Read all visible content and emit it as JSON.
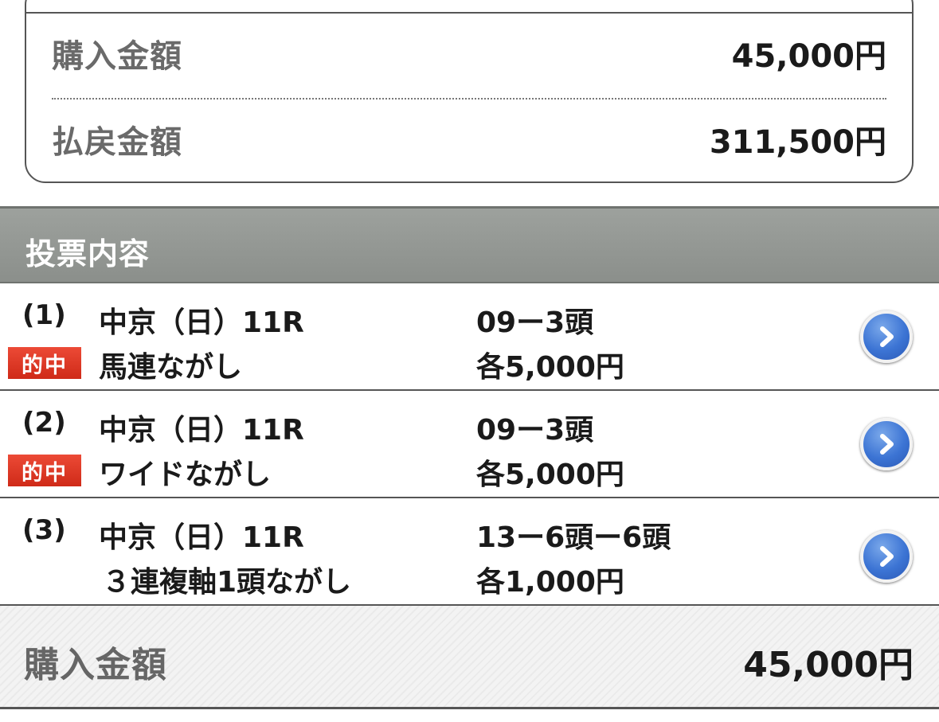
{
  "summary": {
    "purchase_label": "購入金額",
    "purchase_value": "45,000円",
    "payout_label": "払戻金額",
    "payout_value": "311,500円"
  },
  "section": {
    "title": "投票内容"
  },
  "bets": [
    {
      "number": "(1)",
      "badge": "的中",
      "race": "中京（日）11R",
      "type": "馬連ながし",
      "combo": "09ー3頭",
      "amount": "各5,000円"
    },
    {
      "number": "(2)",
      "badge": "的中",
      "race": "中京（日）11R",
      "type": "ワイドながし",
      "combo": "09ー3頭",
      "amount": "各5,000円"
    },
    {
      "number": "(3)",
      "race": "中京（日）11R",
      "type": "３連複軸1頭ながし",
      "combo": "13ー6頭ー6頭",
      "amount": "各1,000円"
    }
  ],
  "footer": {
    "total_label": "購入金額",
    "total_value": "45,000円"
  },
  "icons": {
    "detail_arrow": "chevron-right-icon",
    "accent": "#3c74d4",
    "hit_badge_color": "#d9301c"
  }
}
